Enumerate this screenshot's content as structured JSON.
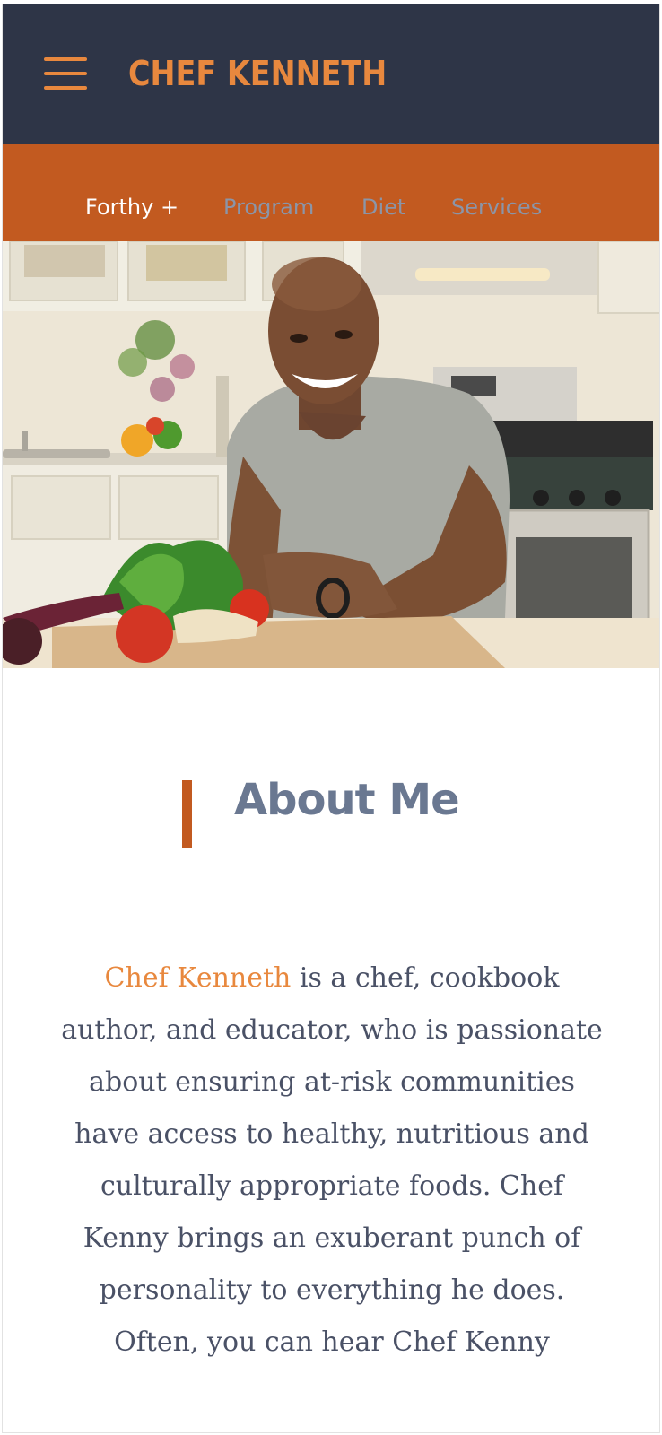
{
  "header": {
    "brand": "CHEF KENNETH",
    "menu_icon": "hamburger-menu-icon"
  },
  "nav": {
    "items": [
      {
        "label": "Forthy +",
        "active": true
      },
      {
        "label": "Program",
        "active": false
      },
      {
        "label": "Diet",
        "active": false
      },
      {
        "label": "Services",
        "active": false
      }
    ]
  },
  "hero": {
    "image": "photo of smiling chef leaning on kitchen counter with vegetables"
  },
  "about": {
    "title": "About Me",
    "highlight_name": "Chef Kenneth",
    "body": " is a chef, cookbook author, and educator, who is passionate about ensuring at-risk communities have access to healthy, nutritious and culturally appropriate foods. Chef Kenny brings an exuberant punch of personality to everything he does. Often, you can hear Chef Kenny"
  },
  "colors": {
    "header_bg": "#2e3547",
    "nav_bg": "#c25a20",
    "accent": "#e8883e",
    "nav_active": "#ffffff",
    "nav_inactive": "#8b95a8",
    "title_color": "#6a7891",
    "body_text": "#4a5166"
  }
}
